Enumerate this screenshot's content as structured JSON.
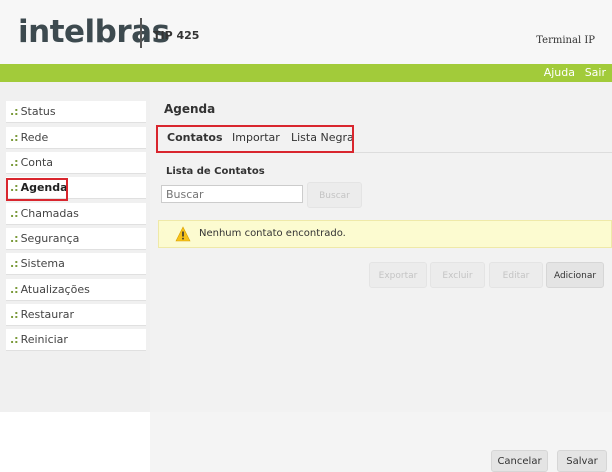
{
  "header": {
    "brand": "intelbras",
    "model": "TIP 425",
    "product_label": "Terminal IP"
  },
  "top_links": {
    "help": "Ajuda",
    "logout": "Sair"
  },
  "sidebar": {
    "items": [
      {
        "label": "Status"
      },
      {
        "label": "Rede"
      },
      {
        "label": "Conta"
      },
      {
        "label": "Agenda"
      },
      {
        "label": "Chamadas"
      },
      {
        "label": "Segurança"
      },
      {
        "label": "Sistema"
      },
      {
        "label": "Atualizações"
      },
      {
        "label": "Restaurar"
      },
      {
        "label": "Reiniciar"
      }
    ],
    "bullet": ".:"
  },
  "main": {
    "page_title": "Agenda",
    "tabs": [
      {
        "label": "Contatos"
      },
      {
        "label": "Importar"
      },
      {
        "label": "Lista Negra"
      }
    ],
    "section_title": "Lista de Contatos",
    "search": {
      "placeholder": "Buscar",
      "button_label": "Buscar"
    },
    "warning_message": "Nenhum contato encontrado.",
    "actions": {
      "export": "Exportar",
      "delete": "Excluir",
      "edit": "Editar",
      "add": "Adicionar"
    },
    "footer": {
      "cancel": "Cancelar",
      "save": "Salvar"
    }
  },
  "colors": {
    "accent_green": "#a2cb3a",
    "highlight_red": "#d9262e",
    "warning_bg": "#fcfbd0"
  }
}
